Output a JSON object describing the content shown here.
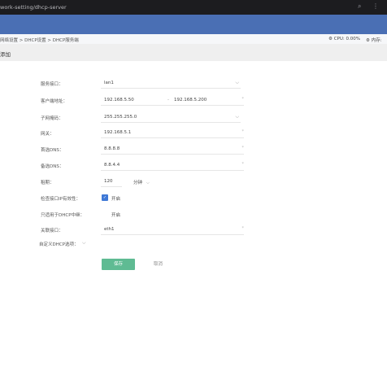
{
  "titlebar": {
    "title": "work-setting/dhcp-server",
    "icons": [
      "search-icon",
      "more-icon"
    ]
  },
  "breadcrumb": {
    "text": "网络设置 > DHCP设置 > DHCP服务端",
    "cpu": "CPU: 0.00%",
    "memory": "内存:"
  },
  "subheader": {
    "title": "添加"
  },
  "form": {
    "service_interface": {
      "label": "服务接口：",
      "value": "lan1"
    },
    "address_pool": {
      "label": "客户端地址：",
      "start": "192.168.5.50",
      "separator": "-",
      "end": "192.168.5.200"
    },
    "subnet_mask": {
      "label": "子网掩码：",
      "value": "255.255.255.0"
    },
    "gateway": {
      "label": "网关：",
      "value": "192.168.5.1"
    },
    "primary_dns": {
      "label": "首选DNS：",
      "value": "8.8.8.8"
    },
    "secondary_dns": {
      "label": "备选DNS：",
      "value": "8.8.4.4"
    },
    "lease": {
      "label": "租期：",
      "value": "120",
      "unit": "分钟"
    },
    "check_ip": {
      "label": "检查接口IP有效性：",
      "text": "开启",
      "checked": true
    },
    "relay_only": {
      "label": "只适用于DHCP中继：",
      "text": "开启",
      "checked": false
    },
    "linked_interface": {
      "label": "关联接口：",
      "value": "eth1"
    },
    "custom_options": {
      "label": "自定义DHCP选项："
    }
  },
  "buttons": {
    "save": "保存",
    "cancel": "取消"
  }
}
